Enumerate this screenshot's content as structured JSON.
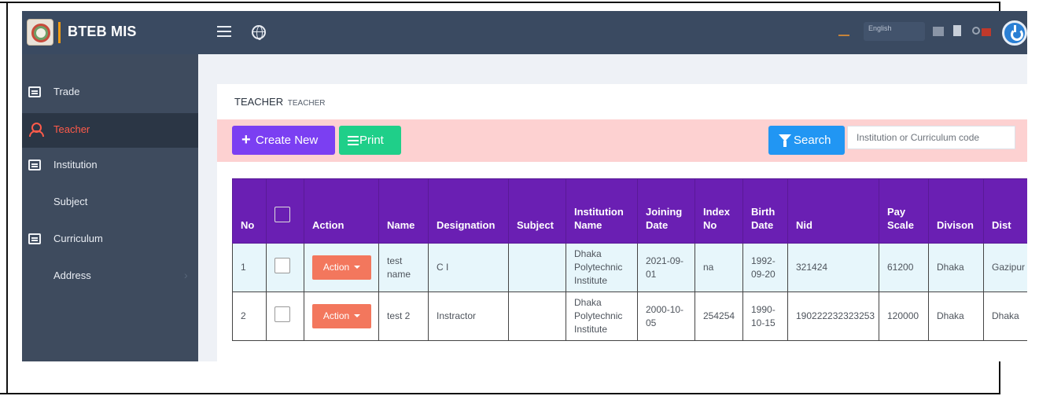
{
  "app": {
    "brand_title": "BTEB MIS"
  },
  "topbar": {
    "language": "English"
  },
  "sidebar": {
    "items": [
      {
        "label": "Trade"
      },
      {
        "label": "Teacher"
      },
      {
        "label": "Institution"
      },
      {
        "label": "Subject"
      },
      {
        "label": "Curriculum"
      },
      {
        "label": "Address"
      }
    ],
    "chevron": "›"
  },
  "page": {
    "title": "TEACHER",
    "subtitle": "TEACHER"
  },
  "toolbar": {
    "create_label": "Create New",
    "print_label": "Print",
    "search_label": "Search",
    "search_placeholder": "Institution or Curriculum code"
  },
  "table": {
    "headers": [
      "No",
      "",
      "Action",
      "Name",
      "Designation",
      "Subject",
      "Institution Name",
      "Joining Date",
      "Index No",
      "Birth Date",
      "Nid",
      "Pay Scale",
      "Divison",
      "Dist"
    ],
    "action_label": "Action",
    "rows": [
      {
        "no": "1",
        "name": "test name",
        "designation": "C I",
        "subject": "",
        "institution": "Dhaka Polytechnic Institute",
        "joining_date": "2021-09-01",
        "index_no": "na",
        "birth_date": "1992-09-20",
        "nid": "321424",
        "pay_scale": "61200",
        "division": "Dhaka",
        "district": "Gazipur"
      },
      {
        "no": "2",
        "name": "test 2",
        "designation": "Instractor",
        "subject": "",
        "institution": "Dhaka Polytechnic Institute",
        "joining_date": "2000-10-05",
        "index_no": "254254",
        "birth_date": "1990-10-15",
        "nid": "190222232323253",
        "pay_scale": "120000",
        "division": "Dhaka",
        "district": "Dhaka"
      }
    ]
  },
  "colors": {
    "topbar": "#3a4a61",
    "sidebar": "#3e4b5e",
    "active_item": "#ff5b4a",
    "create_button": "#7b3ff2",
    "print_button": "#1fcf89",
    "search_button": "#2196f3",
    "table_header": "#6a1fb3",
    "action_button": "#f3775d",
    "toolbar_bg": "#fdd1d1"
  },
  "icons": [
    "hamburger-icon",
    "globe-icon",
    "power-icon",
    "plus-icon",
    "list-icon",
    "filter-icon",
    "caret-down-icon",
    "chevron-right-icon"
  ]
}
